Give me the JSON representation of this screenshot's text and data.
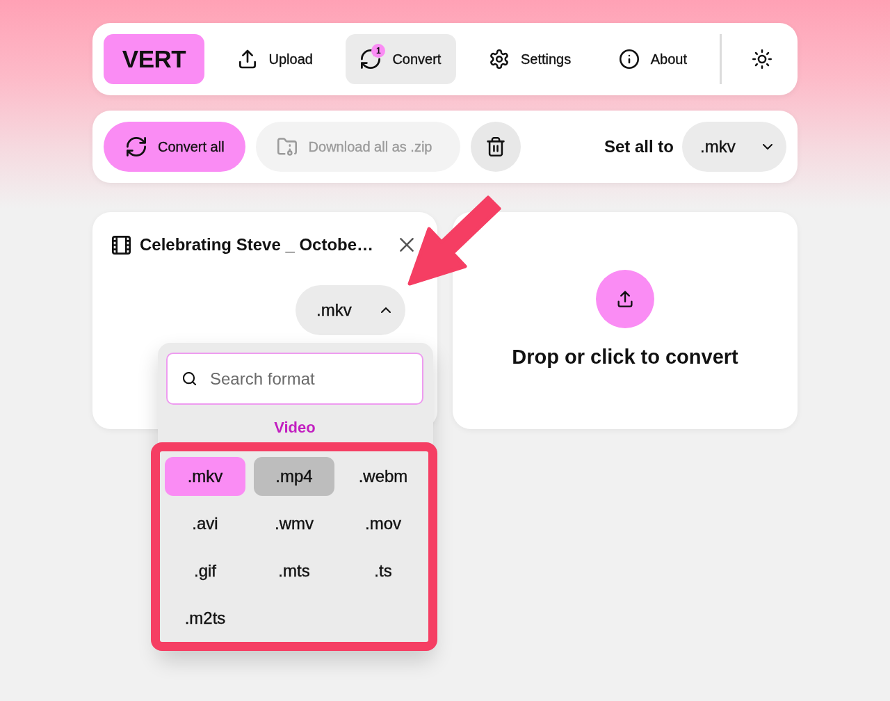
{
  "nav": {
    "logo": "VERT",
    "items": [
      {
        "kind": "upload",
        "label": "Upload",
        "selected": false
      },
      {
        "kind": "convert",
        "label": "Convert",
        "selected": true,
        "badge": "1"
      },
      {
        "kind": "settings",
        "label": "Settings",
        "selected": false
      },
      {
        "kind": "about",
        "label": "About",
        "selected": false
      }
    ]
  },
  "toolbar": {
    "convert_all": "Convert all",
    "download_all": {
      "label": "Download all as .zip",
      "disabled": true
    },
    "set_all": {
      "label": "Set all to",
      "value": ".mkv",
      "expanded": false
    }
  },
  "files": [
    {
      "name": "Celebrating Steve _ Octobe…",
      "format": ".mkv",
      "expanded": true,
      "menu": {
        "placeholder": "Search format",
        "category": "Video",
        "formats": [
          {
            "label": ".mkv",
            "selected": true,
            "hovered": false
          },
          {
            "label": ".mp4",
            "selected": false,
            "hovered": true
          },
          {
            "label": ".webm",
            "selected": false,
            "hovered": false
          },
          {
            "label": ".avi",
            "selected": false,
            "hovered": false
          },
          {
            "label": ".wmv",
            "selected": false,
            "hovered": false
          },
          {
            "label": ".mov",
            "selected": false,
            "hovered": false
          },
          {
            "label": ".gif",
            "selected": false,
            "hovered": false
          },
          {
            "label": ".mts",
            "selected": false,
            "hovered": false
          },
          {
            "label": ".ts",
            "selected": false,
            "hovered": false
          },
          {
            "label": ".m2ts",
            "selected": false,
            "hovered": false
          }
        ]
      }
    }
  ],
  "dropzone": {
    "label": "Drop or click to convert"
  }
}
